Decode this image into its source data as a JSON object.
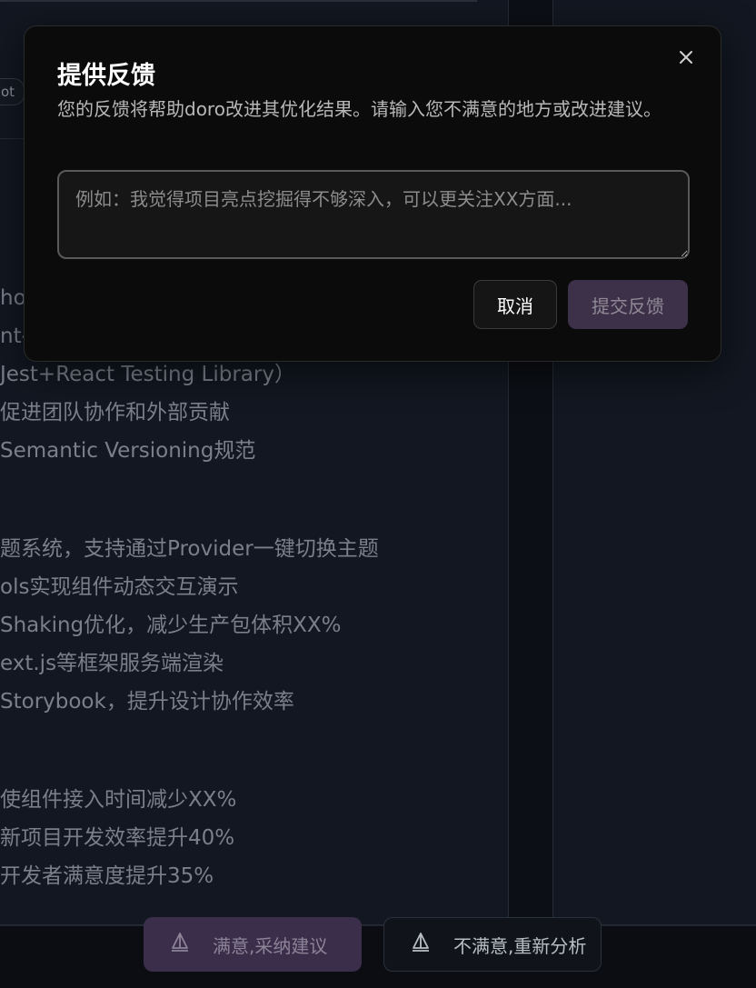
{
  "background": {
    "chip_label": "ot",
    "lines_group1": [
      "hor",
      "nt-",
      "Jest+React Testing Library）",
      "促进团队协作和外部贡献",
      "Semantic Versioning规范"
    ],
    "lines_group2": [
      "题系统，支持通过Provider一键切换主题",
      "ols实现组件动态交互演示",
      " Shaking优化，减少生产包体积XX%",
      "ext.js等框架服务端渲染",
      "Storybook，提升设计协作效率"
    ],
    "lines_group3": [
      "使组件接入时间减少XX%",
      "新项目开发效率提升40%",
      "开发者满意度提升35%"
    ],
    "footer": {
      "accept_label": "满意,采纳建议",
      "reject_label": "不满意,重新分析",
      "accept_icon": "sail-icon",
      "reject_icon": "sail-icon"
    }
  },
  "modal": {
    "title": "提供反馈",
    "description": "您的反馈将帮助doro改进其优化结果。请输入您不满意的地方或改进建议。",
    "textarea_value": "",
    "textarea_placeholder": "例如：我觉得项目亮点挖掘得不够深入，可以更关注XX方面...",
    "cancel_label": "取消",
    "submit_label": "提交反馈",
    "close_icon": "close-icon"
  },
  "colors": {
    "modal_bg": "#0b0b0b",
    "accent_purple": "#3d3049",
    "page_bg": "#0c0f15"
  }
}
